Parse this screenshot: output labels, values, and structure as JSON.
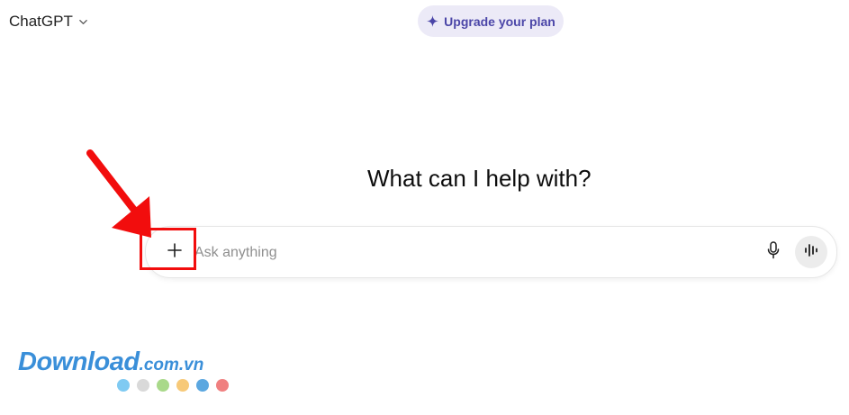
{
  "header": {
    "model_name": "ChatGPT",
    "model_chevron_icon": "chevron-down-icon",
    "upgrade_label": "Upgrade your plan",
    "upgrade_icon": "sparkle-icon",
    "upgrade_color": "#4b46a8"
  },
  "main": {
    "headline": "What can I help with?"
  },
  "composer": {
    "placeholder": "Ask anything",
    "value": "",
    "attach_icon": "plus-icon",
    "mic_icon": "microphone-icon",
    "voice_icon": "voice-waveform-icon"
  },
  "annotation": {
    "arrow_color": "#f20d0d",
    "box_color": "#f20d0d"
  },
  "watermark": {
    "brand": "Download",
    "suffix": ".com.vn",
    "dot_colors": [
      "#7fcaf2",
      "#d9d9d9",
      "#a9d98a",
      "#f7c978",
      "#5ba7e0",
      "#f08080"
    ]
  }
}
